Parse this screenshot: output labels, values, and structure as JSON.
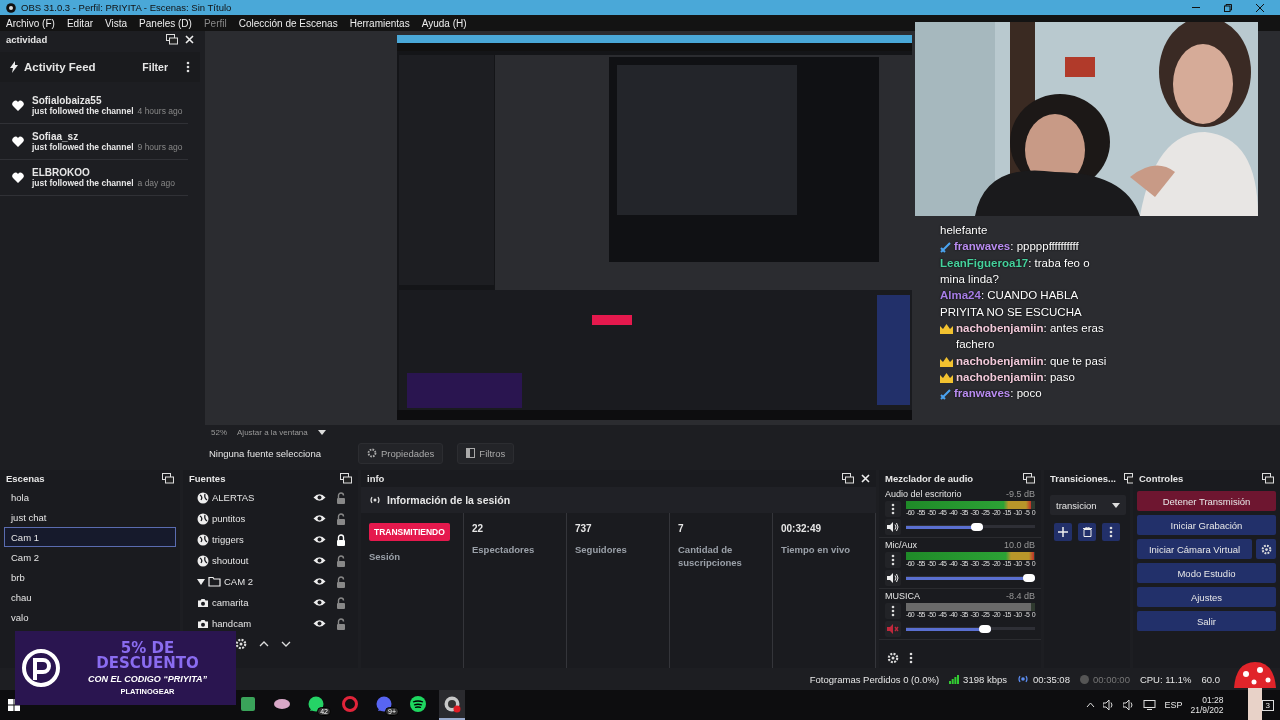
{
  "window": {
    "title": "OBS 31.0.3 - Perfil: PRIYITA - Escenas: Sin Título"
  },
  "menu": [
    {
      "label": "Archivo (F)",
      "disabled": false
    },
    {
      "label": "Editar",
      "disabled": false
    },
    {
      "label": "Vista",
      "disabled": false
    },
    {
      "label": "Paneles (D)",
      "disabled": false
    },
    {
      "label": "Perfil",
      "disabled": true
    },
    {
      "label": "Colección de Escenas",
      "disabled": false
    },
    {
      "label": "Herramientas",
      "disabled": false
    },
    {
      "label": "Ayuda (H)",
      "disabled": false
    }
  ],
  "activity_dock": {
    "title": "actividad",
    "header": "Activity Feed",
    "filter": "Filter",
    "events": [
      {
        "user": "Sofialobaiza55",
        "action": "just followed the channel",
        "time": "4 hours ago"
      },
      {
        "user": "Sofiaa_sz",
        "action": "just followed the channel",
        "time": "9 hours ago"
      },
      {
        "user": "ELBROKOO",
        "action": "just followed the channel",
        "time": "a day ago"
      }
    ]
  },
  "preview": {
    "zoom": "52%",
    "fit": "Ajustar a la ventana"
  },
  "source_toolbar": {
    "status": "Ninguna fuente selecciona",
    "buttons": [
      {
        "kind": "properties",
        "label": "Propiedades"
      },
      {
        "kind": "filters",
        "label": "Filtros"
      }
    ]
  },
  "scenes": {
    "title": "Escenas",
    "items": [
      {
        "name": "hola",
        "selected": false
      },
      {
        "name": "just chat",
        "selected": false
      },
      {
        "name": "Cam 1",
        "selected": true
      },
      {
        "name": "Cam 2",
        "selected": false
      },
      {
        "name": "brb",
        "selected": false
      },
      {
        "name": "chau",
        "selected": false
      },
      {
        "name": "valo",
        "selected": false
      }
    ]
  },
  "sources": {
    "title": "Fuentes",
    "items": [
      {
        "name": "ALERTAS",
        "kind": "browser",
        "visible": true,
        "locked": false
      },
      {
        "name": "puntitos",
        "kind": "browser",
        "visible": true,
        "locked": false
      },
      {
        "name": "triggers",
        "kind": "browser",
        "visible": true,
        "locked": true
      },
      {
        "name": "shoutout",
        "kind": "browser",
        "visible": true,
        "locked": false
      },
      {
        "name": "CAM 2",
        "kind": "group",
        "visible": true,
        "locked": false,
        "expanded": true,
        "children": [
          {
            "name": "camarita",
            "kind": "camera",
            "visible": true,
            "locked": false
          },
          {
            "name": "handcam",
            "kind": "camera",
            "visible": true,
            "locked": false
          }
        ]
      }
    ]
  },
  "info": {
    "title": "info",
    "header": "Información de la sesión",
    "badge": "TRANSMITIENDO",
    "badge_label": "Sesión",
    "stats": [
      {
        "value": "22",
        "label": "Espectadores"
      },
      {
        "value": "737",
        "label": "Seguidores"
      },
      {
        "value": "7",
        "label": "Cantidad de suscripciones"
      },
      {
        "value": "00:32:49",
        "label": "Tiempo en vivo"
      }
    ]
  },
  "mixer": {
    "title": "Mezclador de audio",
    "channels": [
      {
        "name": "Audio del escritorio",
        "reading": "-9.5 dB",
        "muted": false,
        "meter": {
          "level": 0.97
        },
        "volume": {
          "level": 0.6
        },
        "scale": [
          "-60",
          "-55",
          "-50",
          "-45",
          "-40",
          "-35",
          "-30",
          "-25",
          "-20",
          "-15",
          "-10",
          "-5",
          "0"
        ]
      },
      {
        "name": "Mic/Aux",
        "reading": "10.0 dB",
        "muted": false,
        "meter": {
          "level": 0.99
        },
        "volume": {
          "level": 1.0
        },
        "scale": [
          "-60",
          "-55",
          "-50",
          "-45",
          "-40",
          "-35",
          "-30",
          "-25",
          "-20",
          "-15",
          "-10",
          "-5",
          "0"
        ]
      },
      {
        "name": "MUSICA",
        "reading": "-8.4 dB",
        "muted": true,
        "meter": {
          "level": 0.97
        },
        "volume": {
          "level": 0.66
        },
        "scale": [
          "-60",
          "-55",
          "-50",
          "-45",
          "-40",
          "-35",
          "-30",
          "-25",
          "-20",
          "-15",
          "-10",
          "-5",
          "0"
        ]
      }
    ]
  },
  "transitions": {
    "title": "Transiciones...",
    "current": "transicion"
  },
  "controls": {
    "title": "Controles",
    "buttons": [
      {
        "label": "Detener Transmisión",
        "kind": "danger"
      },
      {
        "label": "Iniciar Grabación",
        "kind": "primary"
      },
      {
        "label": "Iniciar Cámara Virtual",
        "kind": "with-settings"
      },
      {
        "label": "Modo Estudio",
        "kind": "primary"
      },
      {
        "label": "Ajustes",
        "kind": "primary"
      },
      {
        "label": "Salir",
        "kind": "primary"
      }
    ]
  },
  "status_bar": {
    "dropped": "Fotogramas Perdidos 0 (0.0%)",
    "bitrate": "3198 kbps",
    "live_time": "00:35:08",
    "rec_time": "00:00:00",
    "cpu": "CPU: 11.1%",
    "fps": "60.0"
  },
  "chat": [
    {
      "kind": "text",
      "text": "helefante"
    },
    {
      "kind": "sword",
      "user": "franwaves",
      "color": "#b98cf0",
      "text": ": pppppffffffffff"
    },
    {
      "kind": "plain",
      "user": "LeanFigueroa17",
      "color": "#45d19c",
      "text": ": traba feo o mina linda?"
    },
    {
      "kind": "plain",
      "user": "Alma24",
      "color": "#a77ee6",
      "text": ": CUANDO HABLA PRIYITA NO SE ESCUCHA"
    },
    {
      "kind": "crown",
      "user": "nachobenjamiin",
      "color": "#f2c9da",
      "text": ": antes eras fachero"
    },
    {
      "kind": "crown",
      "user": "nachobenjamiin",
      "color": "#f2c9da",
      "text": ": que te pasi"
    },
    {
      "kind": "crown",
      "user": "nachobenjamiin",
      "color": "#f2c9da",
      "text": ": paso"
    },
    {
      "kind": "sword",
      "user": "franwaves",
      "color": "#b98cf0",
      "text": ": poco"
    }
  ],
  "promo": {
    "lines": [
      "5% DE",
      "DESCUENTO",
      "CON EL CODIGO “PRIYITA”"
    ],
    "brand": "PLATINOGEAR"
  },
  "taskbar": {
    "apps": [
      {
        "kind": "tb",
        "color": "#3aa35a"
      },
      {
        "kind": "app",
        "color": "#d9a8c8"
      },
      {
        "kind": "chat",
        "color": "#25d366",
        "badge": "42"
      },
      {
        "kind": "ring",
        "color": "#e0243a"
      },
      {
        "kind": "chat",
        "color": "#5865f2",
        "badge": "9+"
      },
      {
        "kind": "disc",
        "color": "#1ed760"
      },
      {
        "kind": "record",
        "color": "#c8c8c8",
        "active": true
      }
    ],
    "language": "ESP",
    "time": "01:28",
    "date": "21/9/202",
    "notifications": "3"
  }
}
